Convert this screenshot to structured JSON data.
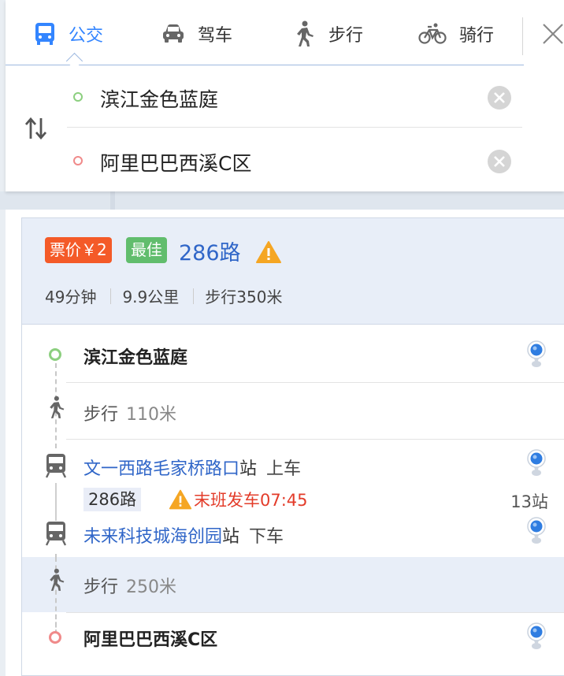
{
  "tabs": [
    {
      "label": "公交",
      "icon": "bus-icon",
      "active": true
    },
    {
      "label": "驾车",
      "icon": "car-icon",
      "active": false
    },
    {
      "label": "步行",
      "icon": "walk-icon",
      "active": false
    },
    {
      "label": "骑行",
      "icon": "bike-icon",
      "active": false
    }
  ],
  "search": {
    "origin": "滨江金色蓝庭",
    "destination": "阿里巴巴西溪C区"
  },
  "plan": {
    "fare_badge": "票价￥2",
    "best_badge": "最佳",
    "route_name": "286路",
    "duration": "49分钟",
    "distance": "9.9公里",
    "walk_total": "步行350米"
  },
  "steps": {
    "start": "滨江金色蓝庭",
    "walk1_label": "步行",
    "walk1_dist": "110米",
    "board_stop": "文一西路毛家桥路口",
    "station_suffix": "站",
    "board_action": "上车",
    "line_tag": "286路",
    "last_bus": "末班发车07:45",
    "stop_count": "13站",
    "alight_stop": "未来科技城海创园",
    "alight_action": "下车",
    "walk2_label": "步行",
    "walk2_dist": "250米",
    "end": "阿里巴巴西溪C区"
  },
  "colors": {
    "accent": "#3385ff",
    "fare_badge": "#f45a28",
    "best_badge": "#61bd6d",
    "route_link": "#3066c8",
    "warning": "#f5a623",
    "last_bus_text": "#e33c2a"
  }
}
